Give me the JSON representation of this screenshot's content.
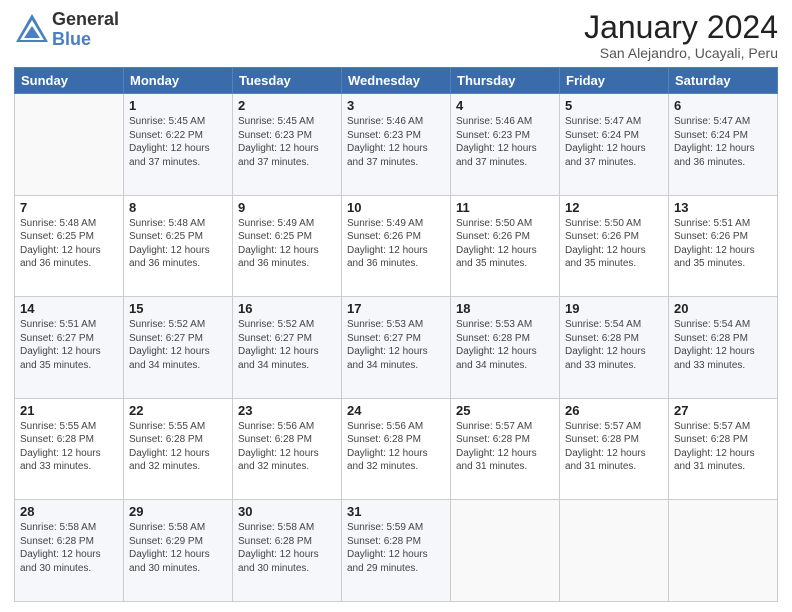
{
  "logo": {
    "general": "General",
    "blue": "Blue"
  },
  "header": {
    "title": "January 2024",
    "subtitle": "San Alejandro, Ucayali, Peru"
  },
  "weekdays": [
    "Sunday",
    "Monday",
    "Tuesday",
    "Wednesday",
    "Thursday",
    "Friday",
    "Saturday"
  ],
  "weeks": [
    [
      {
        "day": "",
        "info": ""
      },
      {
        "day": "1",
        "info": "Sunrise: 5:45 AM\nSunset: 6:22 PM\nDaylight: 12 hours\nand 37 minutes."
      },
      {
        "day": "2",
        "info": "Sunrise: 5:45 AM\nSunset: 6:23 PM\nDaylight: 12 hours\nand 37 minutes."
      },
      {
        "day": "3",
        "info": "Sunrise: 5:46 AM\nSunset: 6:23 PM\nDaylight: 12 hours\nand 37 minutes."
      },
      {
        "day": "4",
        "info": "Sunrise: 5:46 AM\nSunset: 6:23 PM\nDaylight: 12 hours\nand 37 minutes."
      },
      {
        "day": "5",
        "info": "Sunrise: 5:47 AM\nSunset: 6:24 PM\nDaylight: 12 hours\nand 37 minutes."
      },
      {
        "day": "6",
        "info": "Sunrise: 5:47 AM\nSunset: 6:24 PM\nDaylight: 12 hours\nand 36 minutes."
      }
    ],
    [
      {
        "day": "7",
        "info": "Sunrise: 5:48 AM\nSunset: 6:25 PM\nDaylight: 12 hours\nand 36 minutes."
      },
      {
        "day": "8",
        "info": "Sunrise: 5:48 AM\nSunset: 6:25 PM\nDaylight: 12 hours\nand 36 minutes."
      },
      {
        "day": "9",
        "info": "Sunrise: 5:49 AM\nSunset: 6:25 PM\nDaylight: 12 hours\nand 36 minutes."
      },
      {
        "day": "10",
        "info": "Sunrise: 5:49 AM\nSunset: 6:26 PM\nDaylight: 12 hours\nand 36 minutes."
      },
      {
        "day": "11",
        "info": "Sunrise: 5:50 AM\nSunset: 6:26 PM\nDaylight: 12 hours\nand 35 minutes."
      },
      {
        "day": "12",
        "info": "Sunrise: 5:50 AM\nSunset: 6:26 PM\nDaylight: 12 hours\nand 35 minutes."
      },
      {
        "day": "13",
        "info": "Sunrise: 5:51 AM\nSunset: 6:26 PM\nDaylight: 12 hours\nand 35 minutes."
      }
    ],
    [
      {
        "day": "14",
        "info": "Sunrise: 5:51 AM\nSunset: 6:27 PM\nDaylight: 12 hours\nand 35 minutes."
      },
      {
        "day": "15",
        "info": "Sunrise: 5:52 AM\nSunset: 6:27 PM\nDaylight: 12 hours\nand 34 minutes."
      },
      {
        "day": "16",
        "info": "Sunrise: 5:52 AM\nSunset: 6:27 PM\nDaylight: 12 hours\nand 34 minutes."
      },
      {
        "day": "17",
        "info": "Sunrise: 5:53 AM\nSunset: 6:27 PM\nDaylight: 12 hours\nand 34 minutes."
      },
      {
        "day": "18",
        "info": "Sunrise: 5:53 AM\nSunset: 6:28 PM\nDaylight: 12 hours\nand 34 minutes."
      },
      {
        "day": "19",
        "info": "Sunrise: 5:54 AM\nSunset: 6:28 PM\nDaylight: 12 hours\nand 33 minutes."
      },
      {
        "day": "20",
        "info": "Sunrise: 5:54 AM\nSunset: 6:28 PM\nDaylight: 12 hours\nand 33 minutes."
      }
    ],
    [
      {
        "day": "21",
        "info": "Sunrise: 5:55 AM\nSunset: 6:28 PM\nDaylight: 12 hours\nand 33 minutes."
      },
      {
        "day": "22",
        "info": "Sunrise: 5:55 AM\nSunset: 6:28 PM\nDaylight: 12 hours\nand 32 minutes."
      },
      {
        "day": "23",
        "info": "Sunrise: 5:56 AM\nSunset: 6:28 PM\nDaylight: 12 hours\nand 32 minutes."
      },
      {
        "day": "24",
        "info": "Sunrise: 5:56 AM\nSunset: 6:28 PM\nDaylight: 12 hours\nand 32 minutes."
      },
      {
        "day": "25",
        "info": "Sunrise: 5:57 AM\nSunset: 6:28 PM\nDaylight: 12 hours\nand 31 minutes."
      },
      {
        "day": "26",
        "info": "Sunrise: 5:57 AM\nSunset: 6:28 PM\nDaylight: 12 hours\nand 31 minutes."
      },
      {
        "day": "27",
        "info": "Sunrise: 5:57 AM\nSunset: 6:28 PM\nDaylight: 12 hours\nand 31 minutes."
      }
    ],
    [
      {
        "day": "28",
        "info": "Sunrise: 5:58 AM\nSunset: 6:28 PM\nDaylight: 12 hours\nand 30 minutes."
      },
      {
        "day": "29",
        "info": "Sunrise: 5:58 AM\nSunset: 6:29 PM\nDaylight: 12 hours\nand 30 minutes."
      },
      {
        "day": "30",
        "info": "Sunrise: 5:58 AM\nSunset: 6:28 PM\nDaylight: 12 hours\nand 30 minutes."
      },
      {
        "day": "31",
        "info": "Sunrise: 5:59 AM\nSunset: 6:28 PM\nDaylight: 12 hours\nand 29 minutes."
      },
      {
        "day": "",
        "info": ""
      },
      {
        "day": "",
        "info": ""
      },
      {
        "day": "",
        "info": ""
      }
    ]
  ]
}
